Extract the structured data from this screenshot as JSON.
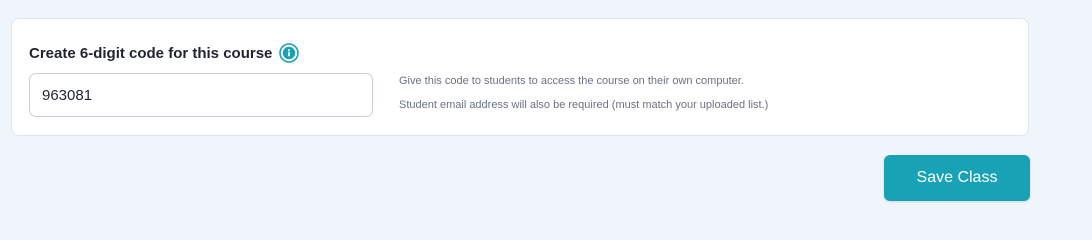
{
  "code_section": {
    "title": "Create 6-digit code for this course",
    "info_icon": "info-icon",
    "code_value": "963081",
    "hint_line_1": "Give this code to students to access the course on their own computer.",
    "hint_line_2": "Student email address will also be required (must match your uploaded list.)"
  },
  "actions": {
    "save_label": "Save Class"
  },
  "colors": {
    "accent": "#17a2b5",
    "background": "#f0f4fb",
    "card": "#ffffff"
  }
}
